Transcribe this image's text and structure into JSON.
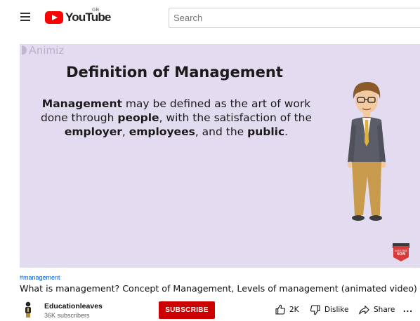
{
  "header": {
    "logo_text": "YouTube",
    "country_code": "GB",
    "search_placeholder": "Search"
  },
  "video": {
    "watermark": "Animiz",
    "slide_title": "Definition of Management",
    "slide_body": {
      "p1_bold": "Management",
      "p1_text": " may be defined as the art of work done through ",
      "p2_bold": "people",
      "p2_text": ", with the satisfaction of the ",
      "p3_bold": "employer",
      "p3_sep": ", ",
      "p4_bold": "employees",
      "p4_text": ", and the ",
      "p5_bold": "public",
      "p5_text": "."
    },
    "badge_text": "SUBSCRIBE NOW"
  },
  "meta": {
    "hashtag": "#management",
    "title": "What is management? Concept of Management, Levels of management (animated video)",
    "channel_name": "Educationleaves",
    "subscriber_count": "36K subscribers",
    "subscribe_label": "SUBSCRIBE",
    "like_count": "2K",
    "dislike_label": "Dislike",
    "share_label": "Share",
    "more_label": "..."
  },
  "colors": {
    "brand_red": "#ff0000",
    "subscribe_red": "#cc0000",
    "player_bg": "#e3dbf0",
    "link_blue": "#065fd4"
  },
  "icons": [
    "menu-icon",
    "youtube-logo-icon",
    "thumbs-up-icon",
    "thumbs-down-icon",
    "share-arrow-icon",
    "more-dots-icon"
  ]
}
